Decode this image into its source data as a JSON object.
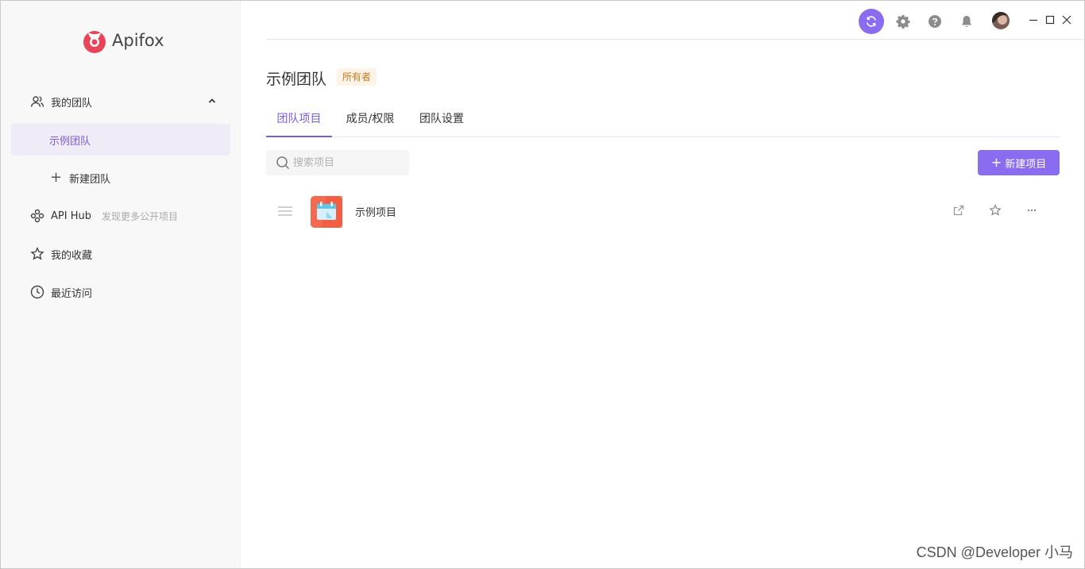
{
  "app": {
    "name": "Apifox",
    "brand_color": "#8a6cf0",
    "logo_color": "#e9445a"
  },
  "sidebar": {
    "my_team": "我的团队",
    "active_team": "示例团队",
    "new_team": "新建团队",
    "api_hub": "API Hub",
    "api_hub_hint": "发现更多公开项目",
    "favorites": "我的收藏",
    "recent": "最近访问"
  },
  "header": {
    "team_name": "示例团队",
    "role_tag": "所有者"
  },
  "tabs": [
    {
      "label": "团队项目",
      "active": true
    },
    {
      "label": "成员/权限",
      "active": false
    },
    {
      "label": "团队设置",
      "active": false
    }
  ],
  "search": {
    "placeholder": "搜索项目",
    "value": ""
  },
  "new_project_button": "新建项目",
  "projects": [
    {
      "name": "示例项目",
      "icon": "calendar-icon"
    }
  ],
  "watermark": "CSDN @Developer 小马"
}
